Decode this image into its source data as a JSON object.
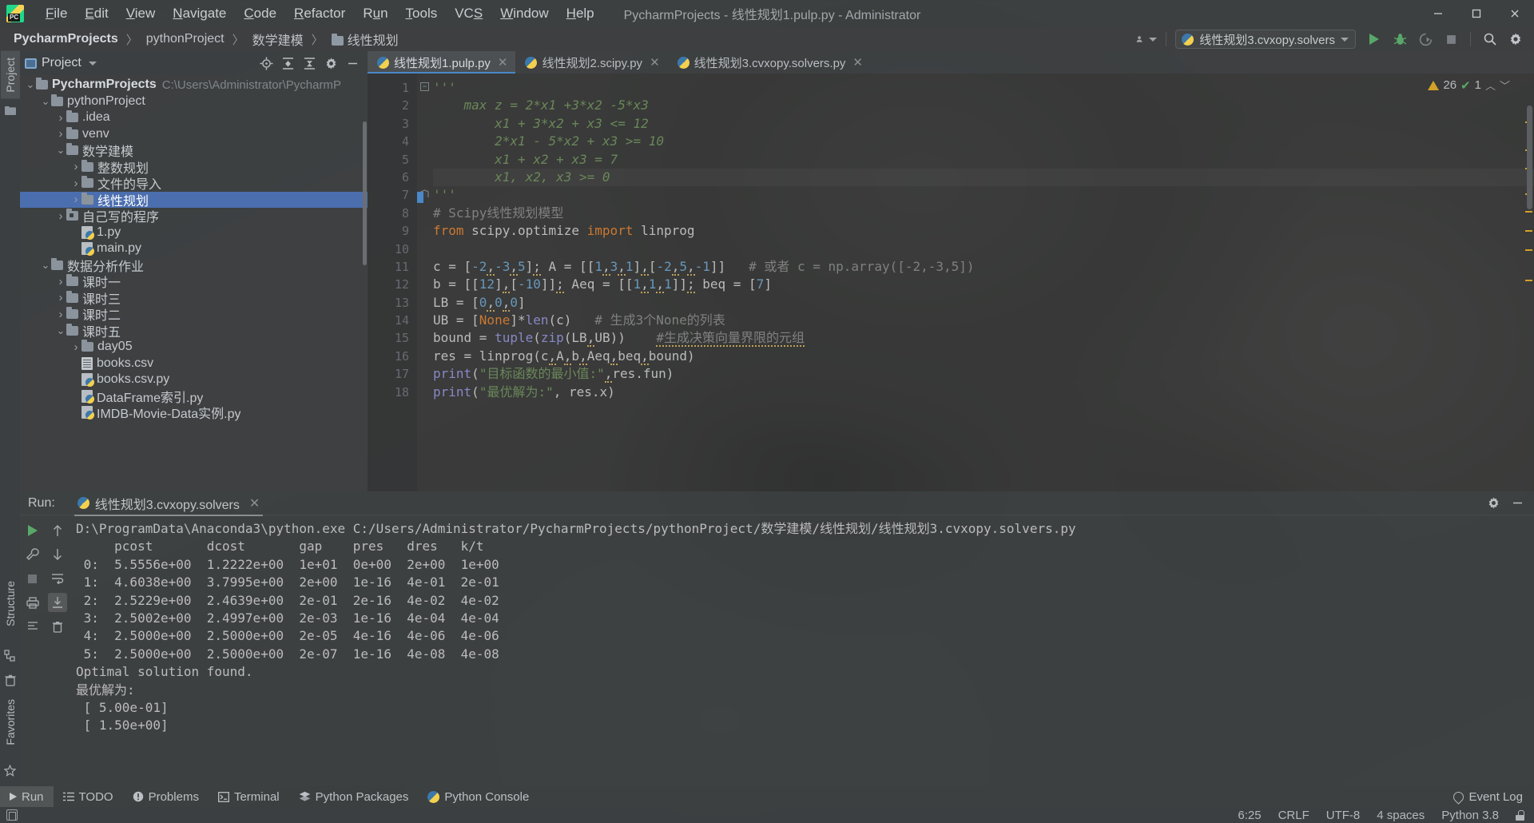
{
  "window": {
    "title": "PycharmProjects - 线性规划1.pulp.py - Administrator",
    "minimize_label": "−",
    "maximize_label": "□",
    "close_label": "✕"
  },
  "menu": [
    {
      "label": "File",
      "mnemonic": "F"
    },
    {
      "label": "Edit",
      "mnemonic": "E"
    },
    {
      "label": "View",
      "mnemonic": "V"
    },
    {
      "label": "Navigate",
      "mnemonic": "N"
    },
    {
      "label": "Code",
      "mnemonic": "C"
    },
    {
      "label": "Refactor",
      "mnemonic": "R"
    },
    {
      "label": "Run",
      "mnemonic": "u"
    },
    {
      "label": "Tools",
      "mnemonic": "T"
    },
    {
      "label": "VCS",
      "mnemonic": "S"
    },
    {
      "label": "Window",
      "mnemonic": "W"
    },
    {
      "label": "Help",
      "mnemonic": "H"
    }
  ],
  "breadcrumb": {
    "items": [
      "PycharmProjects",
      "pythonProject",
      "数学建模",
      "线性规划"
    ],
    "separator": "〉"
  },
  "navbar": {
    "run_config": "线性规划3.cvxopy.solvers",
    "icons": [
      "account-icon",
      "run-icon",
      "debug-icon",
      "run-coverage-icon",
      "stop-icon",
      "search-everywhere-icon",
      "settings-icon"
    ]
  },
  "left_strip": {
    "tabs": [
      "Project",
      "Structure",
      "Favorites"
    ]
  },
  "project_panel": {
    "title": "Project",
    "toolbar_icons": [
      "locate-icon",
      "expand-all-icon",
      "collapse-all-icon",
      "gear-icon",
      "hide-icon"
    ],
    "tree": [
      {
        "depth": 0,
        "arrow": "v",
        "icon": "folder",
        "label": "PycharmProjects",
        "bold": true,
        "path": "C:\\Users\\Administrator\\PycharmP"
      },
      {
        "depth": 1,
        "arrow": "v",
        "icon": "folder",
        "label": "pythonProject",
        "bold": false,
        "path": ""
      },
      {
        "depth": 2,
        "arrow": ">",
        "icon": "folder",
        "label": ".idea",
        "bold": false,
        "path": ""
      },
      {
        "depth": 2,
        "arrow": ">",
        "icon": "folder",
        "label": "venv",
        "bold": false,
        "path": ""
      },
      {
        "depth": 2,
        "arrow": "v",
        "icon": "folder",
        "label": "数学建模",
        "bold": false,
        "path": ""
      },
      {
        "depth": 3,
        "arrow": ">",
        "icon": "folder",
        "label": "整数规划",
        "bold": false,
        "path": ""
      },
      {
        "depth": 3,
        "arrow": ">",
        "icon": "folder",
        "label": "文件的导入",
        "bold": false,
        "path": ""
      },
      {
        "depth": 3,
        "arrow": ">",
        "icon": "folder",
        "label": "线性规划",
        "bold": false,
        "path": "",
        "selected": true
      },
      {
        "depth": 2,
        "arrow": ">",
        "icon": "folder-src",
        "label": "自己写的程序",
        "bold": false,
        "path": ""
      },
      {
        "depth": 3,
        "arrow": "none",
        "icon": "py",
        "label": "1.py",
        "bold": false,
        "path": ""
      },
      {
        "depth": 3,
        "arrow": "none",
        "icon": "py",
        "label": "main.py",
        "bold": false,
        "path": ""
      },
      {
        "depth": 1,
        "arrow": "v",
        "icon": "folder",
        "label": "数据分析作业",
        "bold": false,
        "path": ""
      },
      {
        "depth": 2,
        "arrow": ">",
        "icon": "folder",
        "label": "课时一",
        "bold": false,
        "path": ""
      },
      {
        "depth": 2,
        "arrow": ">",
        "icon": "folder",
        "label": "课时三",
        "bold": false,
        "path": ""
      },
      {
        "depth": 2,
        "arrow": ">",
        "icon": "folder",
        "label": "课时二",
        "bold": false,
        "path": ""
      },
      {
        "depth": 2,
        "arrow": "v",
        "icon": "folder",
        "label": "课时五",
        "bold": false,
        "path": ""
      },
      {
        "depth": 3,
        "arrow": ">",
        "icon": "folder",
        "label": "day05",
        "bold": false,
        "path": ""
      },
      {
        "depth": 3,
        "arrow": "none",
        "icon": "csv",
        "label": "books.csv",
        "bold": false,
        "path": ""
      },
      {
        "depth": 3,
        "arrow": "none",
        "icon": "py",
        "label": "books.csv.py",
        "bold": false,
        "path": ""
      },
      {
        "depth": 3,
        "arrow": "none",
        "icon": "py",
        "label": "DataFrame索引.py",
        "bold": false,
        "path": ""
      },
      {
        "depth": 3,
        "arrow": "none",
        "icon": "py",
        "label": "IMDB-Movie-Data实例.py",
        "bold": false,
        "path": ""
      }
    ]
  },
  "editor": {
    "tabs": [
      {
        "label": "线性规划1.pulp.py",
        "active": true,
        "close": "✕"
      },
      {
        "label": "线性规划2.scipy.py",
        "active": false,
        "close": "✕"
      },
      {
        "label": "线性规划3.cvxopy.solvers.py",
        "active": false,
        "close": "✕"
      }
    ],
    "inspection": {
      "warnings": "26",
      "checks": "1"
    },
    "lines": [
      {
        "n": "1",
        "text": "'''",
        "indent": 0
      },
      {
        "n": "2",
        "text": "    max z = 2*x1 +3*x2 -5*x3",
        "indent": 0
      },
      {
        "n": "3",
        "text": "        x1 + 3*x2 + x3 <= 12",
        "indent": 0
      },
      {
        "n": "4",
        "text": "        2*x1 - 5*x2 + x3 >= 10",
        "indent": 0
      },
      {
        "n": "5",
        "text": "        x1 + x2 + x3 = 7",
        "indent": 0
      },
      {
        "n": "6",
        "text": "        x1, x2, x3 >= 0",
        "indent": 0
      },
      {
        "n": "7",
        "text": "'''",
        "indent": 0
      },
      {
        "n": "8",
        "text": "# Scipy线性规划模型",
        "indent": 0
      },
      {
        "n": "9",
        "text": "from scipy.optimize import linprog",
        "indent": 0
      },
      {
        "n": "10",
        "text": "",
        "indent": 0
      },
      {
        "n": "11",
        "text": "c = [-2,-3,5]; A = [[1,3,1],[-2,5,-1]]   # 或者 c = np.array([-2,-3,5])",
        "indent": 0
      },
      {
        "n": "12",
        "text": "b = [[12],[-10]]; Aeq = [[1,1,1]]; beq = [7]",
        "indent": 0
      },
      {
        "n": "13",
        "text": "LB = [0,0,0]",
        "indent": 0
      },
      {
        "n": "14",
        "text": "UB = [None]*len(c)   # 生成3个None的列表",
        "indent": 0
      },
      {
        "n": "15",
        "text": "bound = tuple(zip(LB,UB))    #生成决策向量界限的元组",
        "indent": 0
      },
      {
        "n": "16",
        "text": "res = linprog(c,A,b,Aeq,beq,bound)",
        "indent": 0
      },
      {
        "n": "17",
        "text": "print(\"目标函数的最小值:\",res.fun)",
        "indent": 0
      },
      {
        "n": "18",
        "text": "print(\"最优解为:\", res.x)",
        "indent": 0
      }
    ]
  },
  "run_panel": {
    "label": "Run:",
    "tab_title": "线性规划3.cvxopy.solvers",
    "tab_close": "✕",
    "header_icons": [
      "gear-icon",
      "hide-icon"
    ],
    "toolbar_icons": [
      "rerun-icon",
      "scroll-up-icon",
      "settings-wrench-icon",
      "scroll-down-icon",
      "stop-icon",
      "wrap-text-icon",
      "print-icon",
      "scroll-to-end-icon",
      "clear-all-icon",
      "trash-icon"
    ],
    "output": [
      "D:\\ProgramData\\Anaconda3\\python.exe C:/Users/Administrator/PycharmProjects/pythonProject/数学建模/线性规划/线性规划3.cvxopy.solvers.py",
      "     pcost       dcost       gap    pres   dres   k/t",
      " 0:  5.5556e+00  1.2222e+00  1e+01  0e+00  2e+00  1e+00",
      " 1:  4.6038e+00  3.7995e+00  2e+00  1e-16  4e-01  2e-01",
      " 2:  2.5229e+00  2.4639e+00  2e-01  2e-16  4e-02  4e-02",
      " 3:  2.5002e+00  2.4997e+00  2e-03  1e-16  4e-04  4e-04",
      " 4:  2.5000e+00  2.5000e+00  2e-05  4e-16  4e-06  4e-06",
      " 5:  2.5000e+00  2.5000e+00  2e-07  1e-16  4e-08  4e-08",
      "Optimal solution found.",
      "最优解为:",
      " [ 5.00e-01]",
      " [ 1.50e+00]"
    ]
  },
  "bottom_bar": {
    "items": [
      {
        "label": "Run",
        "icon": "play-icon",
        "active": true
      },
      {
        "label": "TODO",
        "icon": "list-icon",
        "active": false
      },
      {
        "label": "Problems",
        "icon": "warning-circle-icon",
        "active": false
      },
      {
        "label": "Terminal",
        "icon": "terminal-icon",
        "active": false
      },
      {
        "label": "Python Packages",
        "icon": "layers-icon",
        "active": false
      },
      {
        "label": "Python Console",
        "icon": "python-icon",
        "active": false
      }
    ],
    "event_log": "Event Log"
  },
  "status_bar": {
    "caret": "6:25",
    "line_separator": "CRLF",
    "encoding": "UTF-8",
    "indent": "4 spaces",
    "interpreter": "Python 3.8",
    "lock_icon": "lock-icon"
  },
  "colors": {
    "accent_blue": "#4b6eaf",
    "tab_underline": "#4a88c7",
    "run_green": "#59a869",
    "warn_yellow": "#d4a12a",
    "string_green": "#6a8759",
    "keyword_orange": "#cc7832",
    "number_blue": "#6897bb",
    "comment_gray": "#808080",
    "chrome_bg": "#3c3f41"
  }
}
